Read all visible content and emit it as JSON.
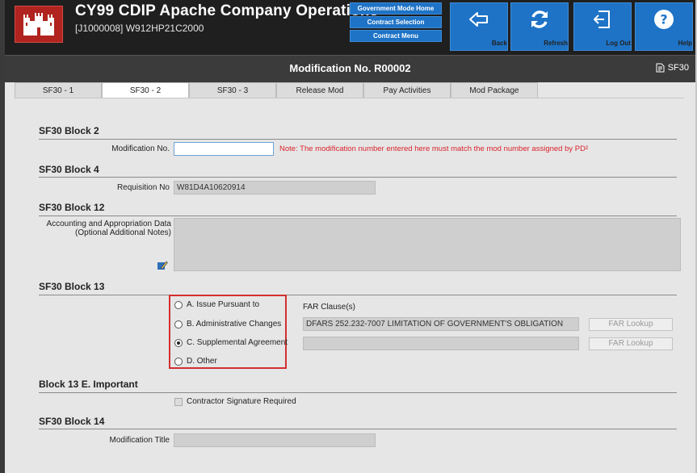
{
  "header": {
    "title": "CY99 CDIP Apache Company Operations",
    "subtitle": "[J1000008] W912HP21C2000",
    "nav_stack": [
      "Government Mode Home",
      "Contract Selection",
      "Contract Menu"
    ],
    "tiles": [
      {
        "label": "Back",
        "icon": "back-arrow-icon"
      },
      {
        "label": "Refresh",
        "icon": "refresh-icon"
      },
      {
        "label": "Log Out",
        "icon": "logout-icon"
      },
      {
        "label": "Help",
        "icon": "help-icon"
      }
    ]
  },
  "mod_bar": {
    "title": "Modification No. R00002",
    "sf30_link": "SF30"
  },
  "tabs": [
    "SF30 - 1",
    "SF30 - 2",
    "SF30 - 3",
    "Release Mod",
    "Pay Activities",
    "Mod Package"
  ],
  "active_tab": "SF30 - 2",
  "block2": {
    "heading": "SF30 Block 2",
    "label": "Modification No.",
    "value": "",
    "note": "Note: The modification number entered here must match the mod number assigned by PD²"
  },
  "block4": {
    "heading": "SF30 Block 4",
    "label": "Requisition No",
    "value": "W81D4A10620914"
  },
  "block12": {
    "heading": "SF30 Block 12",
    "label_line1": "Accounting and Appropriation Data",
    "label_line2": "(Optional Additional Notes)",
    "value": ""
  },
  "block13": {
    "heading": "SF30 Block 13",
    "options": [
      {
        "label": "A. Issue Pursuant to",
        "selected": false
      },
      {
        "label": "B. Administrative Changes",
        "selected": false
      },
      {
        "label": "C. Supplemental Agreement",
        "selected": true
      },
      {
        "label": "D. Other",
        "selected": false
      }
    ],
    "far_header": "FAR Clause(s)",
    "far_values": [
      "DFARS 252.232-7007 LIMITATION OF GOVERNMENT'S OBLIGATION",
      ""
    ],
    "far_button": "FAR Lookup"
  },
  "block13e": {
    "heading": "Block 13 E. Important",
    "checkbox_label": "Contractor Signature Required",
    "checked": false
  },
  "block14": {
    "heading": "SF30 Block 14",
    "label": "Modification Title",
    "value": ""
  },
  "colors": {
    "header_bg": "#1f1f1f",
    "tile_blue": "#1e73c6",
    "logo_red": "#b0231e",
    "note_red": "#d9232c",
    "highlight_red": "#d32f2f"
  }
}
